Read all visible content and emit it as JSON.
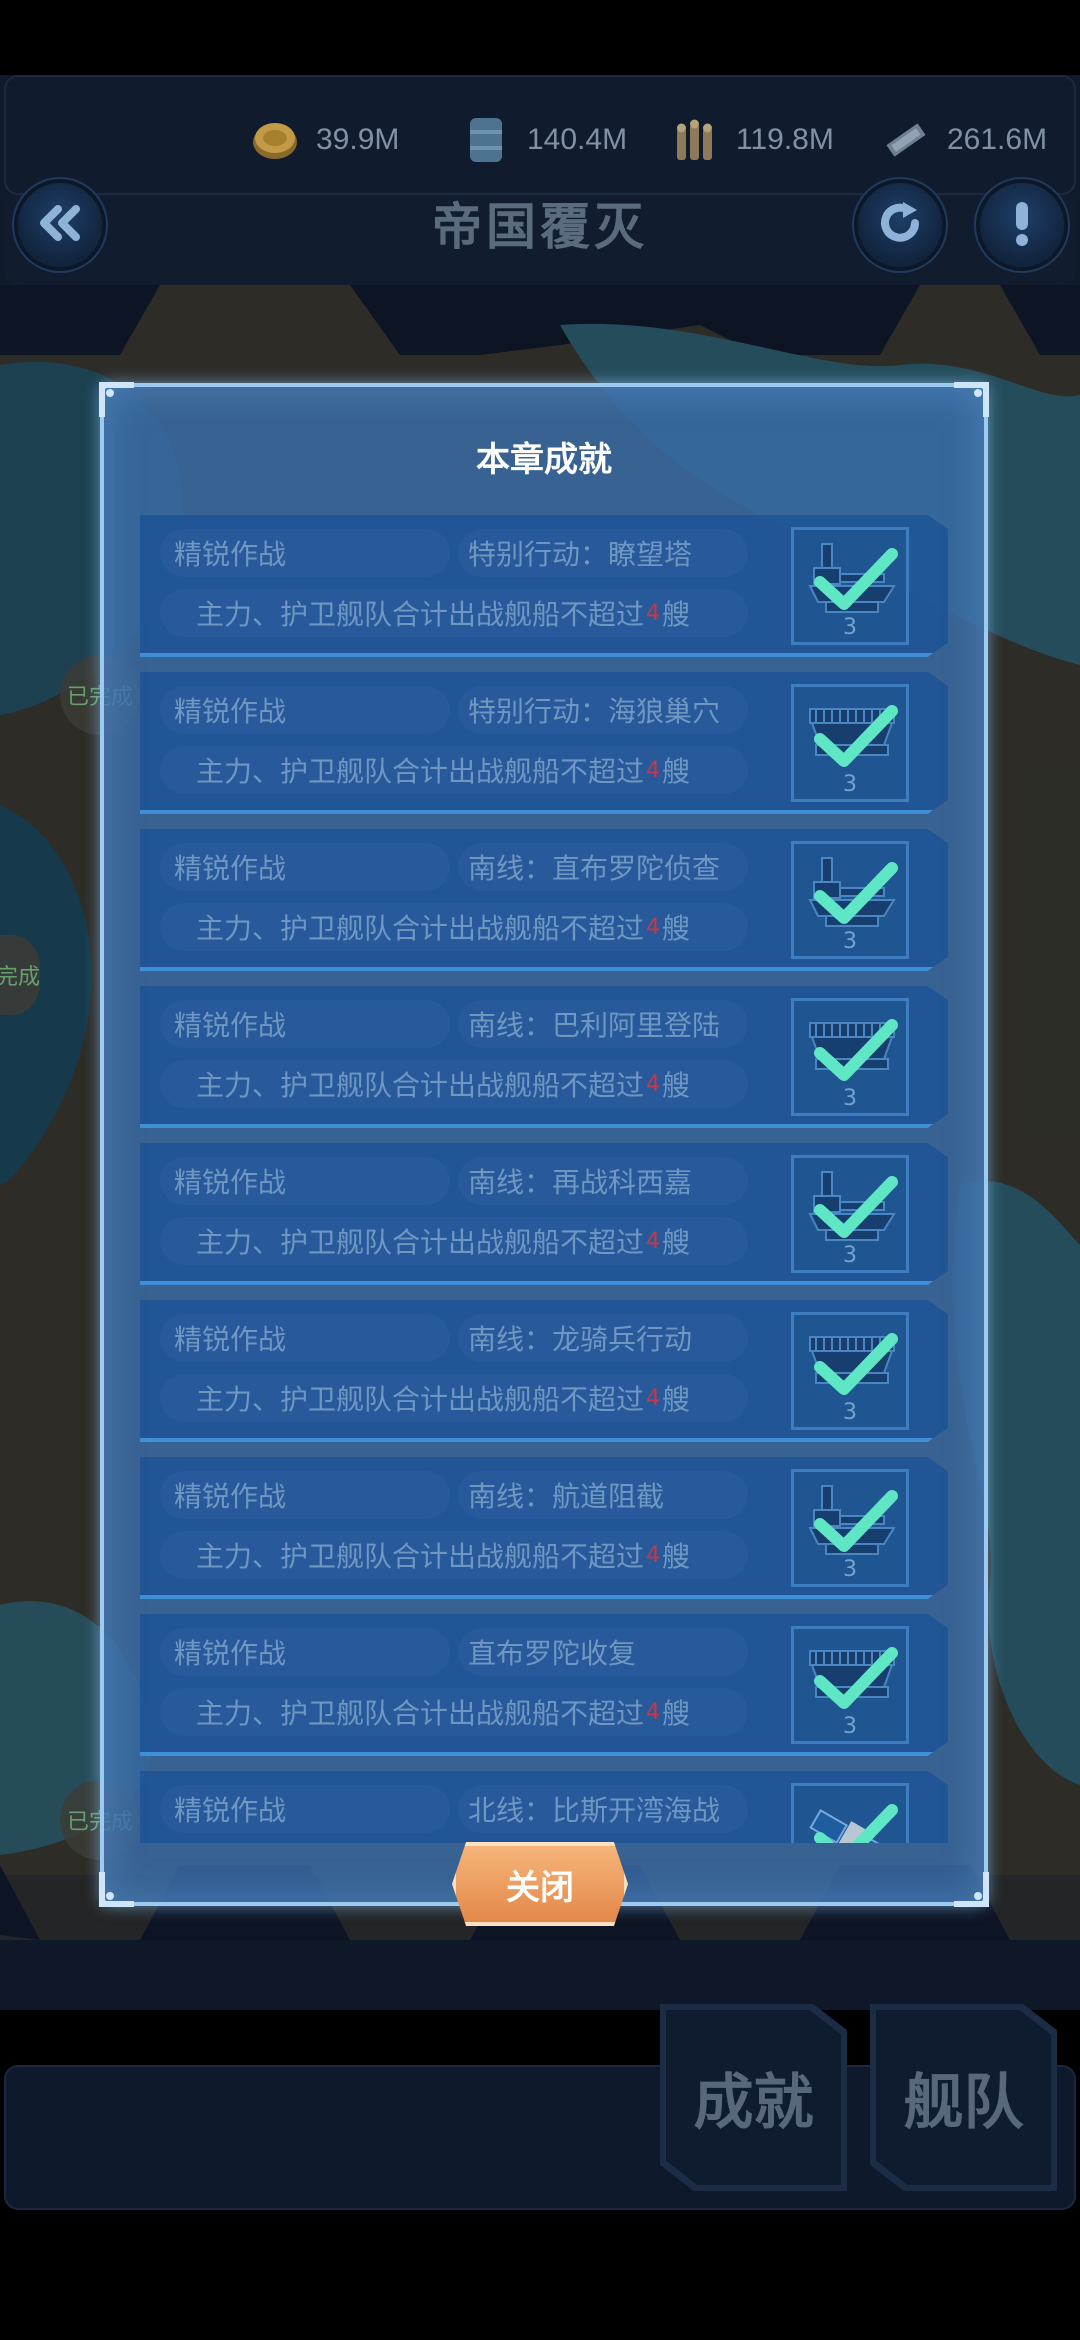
{
  "header": {
    "title": "帝国覆灭",
    "resources": [
      {
        "icon": "gold-coin-icon",
        "value": "39.9M"
      },
      {
        "icon": "fuel-barrel-icon",
        "value": "140.4M"
      },
      {
        "icon": "ammo-icon",
        "value": "119.8M"
      },
      {
        "icon": "steel-icon",
        "value": "261.6M"
      }
    ]
  },
  "dialog": {
    "title": "本章成就",
    "close_label": "关闭",
    "items": [
      {
        "tag": "精锐作战",
        "stage": "特别行动：瞭望塔",
        "condition_pre": "主力、护卫舰队合计出战舰船不超过",
        "condition_num": "4",
        "condition_post": "艘",
        "count": "3",
        "ship": "submarine"
      },
      {
        "tag": "精锐作战",
        "stage": "特别行动：海狼巢穴",
        "condition_pre": "主力、护卫舰队合计出战舰船不超过",
        "condition_num": "4",
        "condition_post": "艘",
        "count": "3",
        "ship": "carrier"
      },
      {
        "tag": "精锐作战",
        "stage": "南线：直布罗陀侦查",
        "condition_pre": "主力、护卫舰队合计出战舰船不超过",
        "condition_num": "4",
        "condition_post": "艘",
        "count": "3",
        "ship": "submarine"
      },
      {
        "tag": "精锐作战",
        "stage": "南线：巴利阿里登陆",
        "condition_pre": "主力、护卫舰队合计出战舰船不超过",
        "condition_num": "4",
        "condition_post": "艘",
        "count": "3",
        "ship": "carrier"
      },
      {
        "tag": "精锐作战",
        "stage": "南线：再战科西嘉",
        "condition_pre": "主力、护卫舰队合计出战舰船不超过",
        "condition_num": "4",
        "condition_post": "艘",
        "count": "3",
        "ship": "submarine"
      },
      {
        "tag": "精锐作战",
        "stage": "南线：龙骑兵行动",
        "condition_pre": "主力、护卫舰队合计出战舰船不超过",
        "condition_num": "4",
        "condition_post": "艘",
        "count": "3",
        "ship": "carrier"
      },
      {
        "tag": "精锐作战",
        "stage": "南线：航道阻截",
        "condition_pre": "主力、护卫舰队合计出战舰船不超过",
        "condition_num": "4",
        "condition_post": "艘",
        "count": "3",
        "ship": "submarine"
      },
      {
        "tag": "精锐作战",
        "stage": "直布罗陀收复",
        "condition_pre": "主力、护卫舰队合计出战舰船不超过",
        "condition_num": "4",
        "condition_post": "艘",
        "count": "3",
        "ship": "carrier"
      },
      {
        "tag": "精锐作战",
        "stage": "北线：比斯开湾海战",
        "condition_pre": "",
        "condition_num": "",
        "condition_post": "",
        "count": "",
        "ship": "satellite"
      }
    ]
  },
  "map": {
    "labels": [
      "已完成",
      "已完成",
      "已完成"
    ]
  },
  "bottom": {
    "achievements_label": "成就",
    "fleet_label": "舰队"
  },
  "colors": {
    "check": "#5fe6c4",
    "close_button": "#e8904f",
    "dialog_border": "#9ccaf0"
  }
}
